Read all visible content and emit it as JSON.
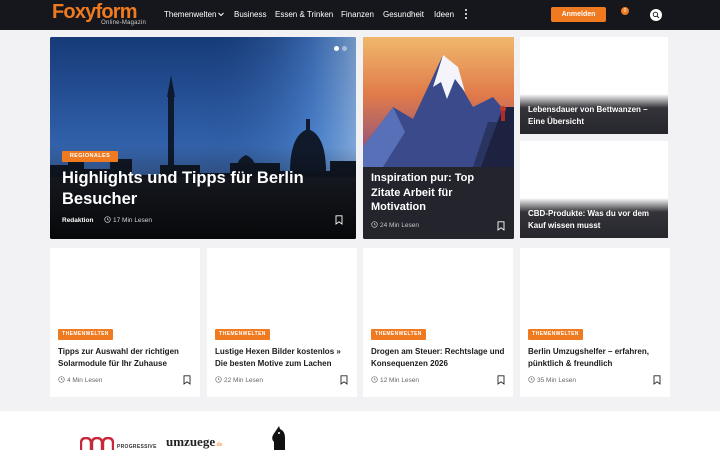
{
  "nav": {
    "logo_main": "Foxyform",
    "logo_sub": "Online-Magazin",
    "items": [
      "Themenwelten",
      "Business",
      "Essen & Trinken",
      "Finanzen",
      "Gesundheit",
      "Ideen"
    ],
    "login_label": "Anmelden",
    "cart_count": "0"
  },
  "hero": {
    "badge": "REGIONALES",
    "title": "Highlights und Tipps für Berlin Besucher",
    "author": "Redaktion",
    "read_time": "17 Min Lesen",
    "slide_count": 2,
    "active_slide": 1
  },
  "feature": {
    "title": "Inspiration pur: Top Zitate Arbeit für Motivation",
    "read_time": "24 Min Lesen"
  },
  "side_cards": [
    {
      "title": "Lebensdauer von Bettwanzen – Eine Übersicht"
    },
    {
      "title": "CBD-Produkte: Was du vor dem Kauf wissen musst"
    }
  ],
  "cards": [
    {
      "badge": "THEMENWELTEN",
      "title": "Tipps zur Auswahl der richtigen Solarmodule für Ihr Zuhause",
      "read_time": "4 Min Lesen"
    },
    {
      "badge": "THEMENWELTEN",
      "title": "Lustige Hexen Bilder kostenlos » Die besten Motive zum Lachen",
      "read_time": "22 Min Lesen"
    },
    {
      "badge": "THEMENWELTEN",
      "title": "Drogen am Steuer: Rechtslage und Konsequenzen 2026",
      "read_time": "12 Min Lesen"
    },
    {
      "badge": "THEMENWELTEN",
      "title": "Berlin Umzugshelfer – erfahren, pünktlich & freundlich",
      "read_time": "35 Min Lesen"
    }
  ],
  "footer": {
    "partner1": "PROGRESSIVE",
    "partner2": "umzuege",
    "partner2_suffix": ".de"
  },
  "colors": {
    "accent": "#f07a1f",
    "nav_bg": "#16171c",
    "page_bg": "#f2f2f4",
    "dark_card": "#23242c"
  }
}
